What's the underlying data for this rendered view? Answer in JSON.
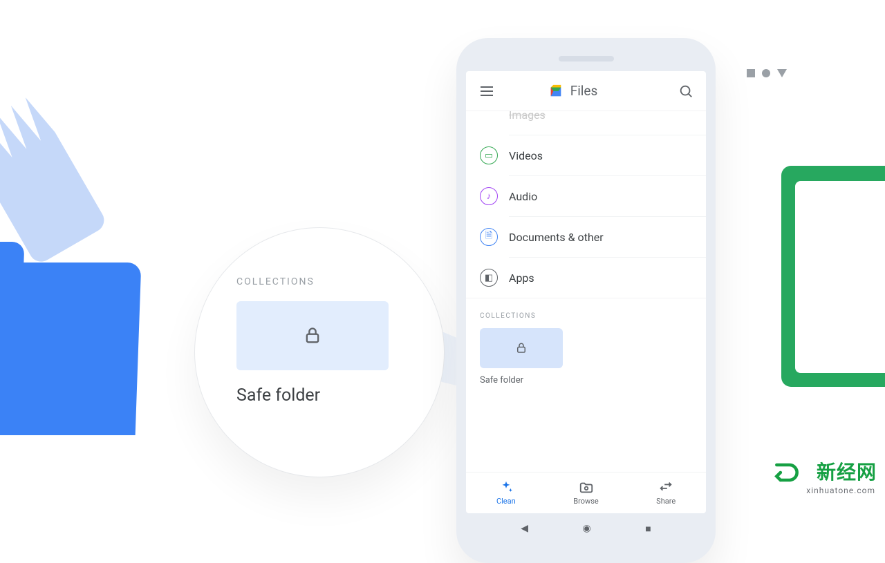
{
  "header": {
    "app_name": "Files"
  },
  "categories": [
    {
      "label": "Images"
    },
    {
      "label": "Videos"
    },
    {
      "label": "Audio"
    },
    {
      "label": "Documents & other"
    },
    {
      "label": "Apps"
    }
  ],
  "collections": {
    "header": "COLLECTIONS",
    "safe_folder_label": "Safe folder"
  },
  "zoom": {
    "section_header": "COLLECTIONS",
    "tile_label": "Safe folder"
  },
  "tabs": [
    {
      "label": "Clean",
      "active": true
    },
    {
      "label": "Browse",
      "active": false
    },
    {
      "label": "Share",
      "active": false
    }
  ],
  "watermark": {
    "brand": "新经网",
    "url": "xinhuatone.com"
  }
}
